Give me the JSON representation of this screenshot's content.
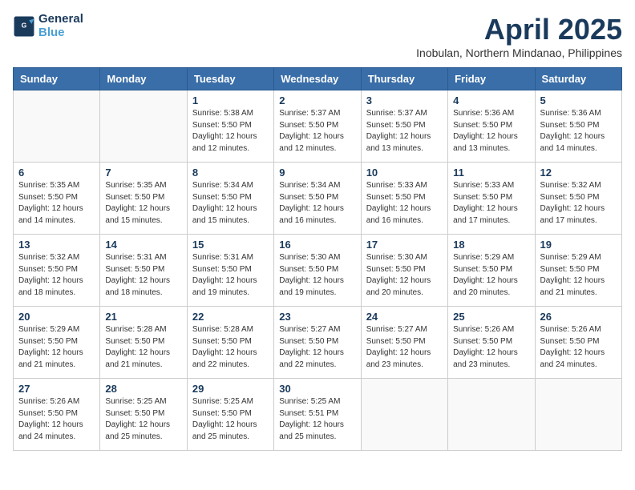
{
  "header": {
    "logo_line1": "General",
    "logo_line2": "Blue",
    "main_title": "April 2025",
    "subtitle": "Inobulan, Northern Mindanao, Philippines"
  },
  "days_of_week": [
    "Sunday",
    "Monday",
    "Tuesday",
    "Wednesday",
    "Thursday",
    "Friday",
    "Saturday"
  ],
  "weeks": [
    [
      {
        "day": "",
        "info": ""
      },
      {
        "day": "",
        "info": ""
      },
      {
        "day": "1",
        "info": "Sunrise: 5:38 AM\nSunset: 5:50 PM\nDaylight: 12 hours\nand 12 minutes."
      },
      {
        "day": "2",
        "info": "Sunrise: 5:37 AM\nSunset: 5:50 PM\nDaylight: 12 hours\nand 12 minutes."
      },
      {
        "day": "3",
        "info": "Sunrise: 5:37 AM\nSunset: 5:50 PM\nDaylight: 12 hours\nand 13 minutes."
      },
      {
        "day": "4",
        "info": "Sunrise: 5:36 AM\nSunset: 5:50 PM\nDaylight: 12 hours\nand 13 minutes."
      },
      {
        "day": "5",
        "info": "Sunrise: 5:36 AM\nSunset: 5:50 PM\nDaylight: 12 hours\nand 14 minutes."
      }
    ],
    [
      {
        "day": "6",
        "info": "Sunrise: 5:35 AM\nSunset: 5:50 PM\nDaylight: 12 hours\nand 14 minutes."
      },
      {
        "day": "7",
        "info": "Sunrise: 5:35 AM\nSunset: 5:50 PM\nDaylight: 12 hours\nand 15 minutes."
      },
      {
        "day": "8",
        "info": "Sunrise: 5:34 AM\nSunset: 5:50 PM\nDaylight: 12 hours\nand 15 minutes."
      },
      {
        "day": "9",
        "info": "Sunrise: 5:34 AM\nSunset: 5:50 PM\nDaylight: 12 hours\nand 16 minutes."
      },
      {
        "day": "10",
        "info": "Sunrise: 5:33 AM\nSunset: 5:50 PM\nDaylight: 12 hours\nand 16 minutes."
      },
      {
        "day": "11",
        "info": "Sunrise: 5:33 AM\nSunset: 5:50 PM\nDaylight: 12 hours\nand 17 minutes."
      },
      {
        "day": "12",
        "info": "Sunrise: 5:32 AM\nSunset: 5:50 PM\nDaylight: 12 hours\nand 17 minutes."
      }
    ],
    [
      {
        "day": "13",
        "info": "Sunrise: 5:32 AM\nSunset: 5:50 PM\nDaylight: 12 hours\nand 18 minutes."
      },
      {
        "day": "14",
        "info": "Sunrise: 5:31 AM\nSunset: 5:50 PM\nDaylight: 12 hours\nand 18 minutes."
      },
      {
        "day": "15",
        "info": "Sunrise: 5:31 AM\nSunset: 5:50 PM\nDaylight: 12 hours\nand 19 minutes."
      },
      {
        "day": "16",
        "info": "Sunrise: 5:30 AM\nSunset: 5:50 PM\nDaylight: 12 hours\nand 19 minutes."
      },
      {
        "day": "17",
        "info": "Sunrise: 5:30 AM\nSunset: 5:50 PM\nDaylight: 12 hours\nand 20 minutes."
      },
      {
        "day": "18",
        "info": "Sunrise: 5:29 AM\nSunset: 5:50 PM\nDaylight: 12 hours\nand 20 minutes."
      },
      {
        "day": "19",
        "info": "Sunrise: 5:29 AM\nSunset: 5:50 PM\nDaylight: 12 hours\nand 21 minutes."
      }
    ],
    [
      {
        "day": "20",
        "info": "Sunrise: 5:29 AM\nSunset: 5:50 PM\nDaylight: 12 hours\nand 21 minutes."
      },
      {
        "day": "21",
        "info": "Sunrise: 5:28 AM\nSunset: 5:50 PM\nDaylight: 12 hours\nand 21 minutes."
      },
      {
        "day": "22",
        "info": "Sunrise: 5:28 AM\nSunset: 5:50 PM\nDaylight: 12 hours\nand 22 minutes."
      },
      {
        "day": "23",
        "info": "Sunrise: 5:27 AM\nSunset: 5:50 PM\nDaylight: 12 hours\nand 22 minutes."
      },
      {
        "day": "24",
        "info": "Sunrise: 5:27 AM\nSunset: 5:50 PM\nDaylight: 12 hours\nand 23 minutes."
      },
      {
        "day": "25",
        "info": "Sunrise: 5:26 AM\nSunset: 5:50 PM\nDaylight: 12 hours\nand 23 minutes."
      },
      {
        "day": "26",
        "info": "Sunrise: 5:26 AM\nSunset: 5:50 PM\nDaylight: 12 hours\nand 24 minutes."
      }
    ],
    [
      {
        "day": "27",
        "info": "Sunrise: 5:26 AM\nSunset: 5:50 PM\nDaylight: 12 hours\nand 24 minutes."
      },
      {
        "day": "28",
        "info": "Sunrise: 5:25 AM\nSunset: 5:50 PM\nDaylight: 12 hours\nand 25 minutes."
      },
      {
        "day": "29",
        "info": "Sunrise: 5:25 AM\nSunset: 5:50 PM\nDaylight: 12 hours\nand 25 minutes."
      },
      {
        "day": "30",
        "info": "Sunrise: 5:25 AM\nSunset: 5:51 PM\nDaylight: 12 hours\nand 25 minutes."
      },
      {
        "day": "",
        "info": ""
      },
      {
        "day": "",
        "info": ""
      },
      {
        "day": "",
        "info": ""
      }
    ]
  ]
}
